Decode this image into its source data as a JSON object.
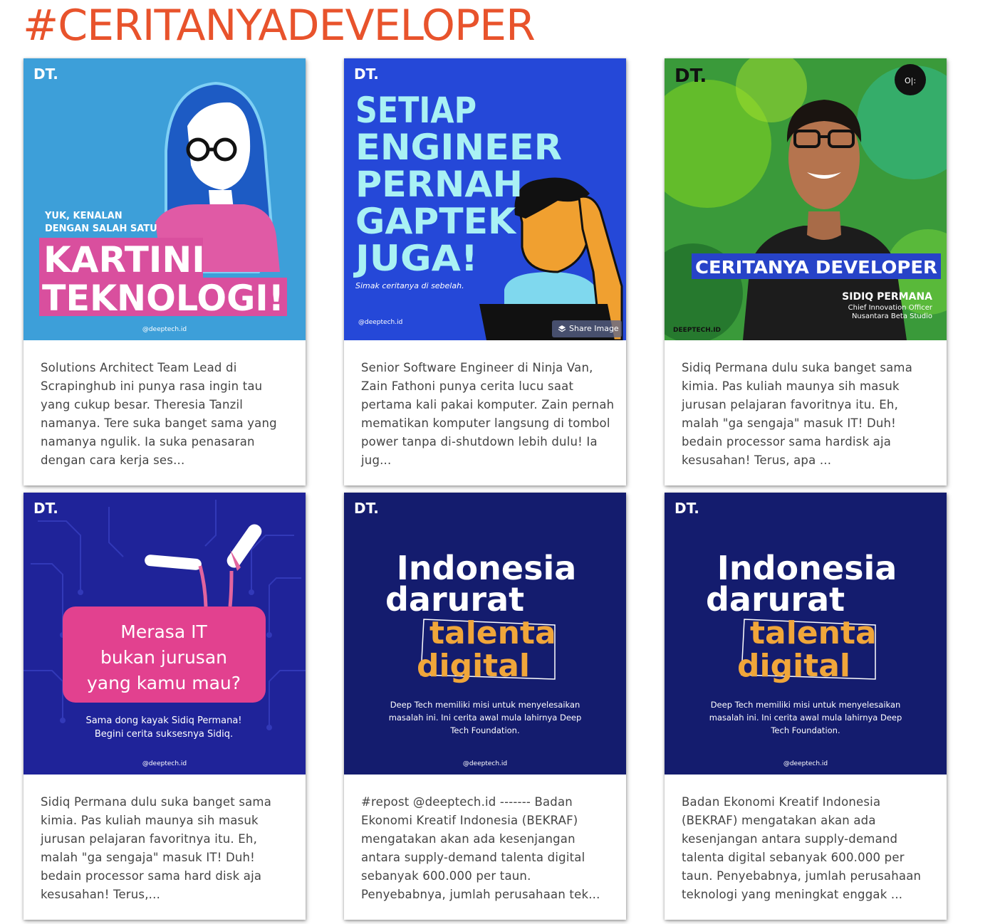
{
  "page": {
    "heading": "#CERITANYADEVELOPER"
  },
  "posts": [
    {
      "image": {
        "logo": "DT.",
        "intro_line1": "YUK, KENALAN",
        "intro_line2": "DENGAN SALAH SATU",
        "title_line1": "KARTINI",
        "title_line2": "TEKNOLOGI!",
        "handle": "@deeptech.id",
        "bg_color": "#3d9fd9"
      },
      "caption": "Solutions Architect Team Lead di Scrapinghub ini punya rasa ingin tau yang cukup besar. Theresia Tanzil namanya.  Tere suka banget sama yang namanya ngulik. Ia suka penasaran dengan cara kerja ses..."
    },
    {
      "image": {
        "logo": "DT.",
        "title_lines": [
          "SETIAP",
          "ENGINEER",
          "PERNAH",
          "GAPTEK",
          "JUGA!"
        ],
        "subtitle": "Simak ceritanya di sebelah.",
        "handle": "@deeptech.id",
        "bg_color": "#2548d8"
      },
      "share_label": "Share Image",
      "caption": "Senior Software Engineer di Ninja Van, Zain Fathoni punya cerita lucu saat pertama kali pakai komputer.  Zain pernah mematikan komputer langsung di tombol power tanpa di-shutdown lebih dulu! Ia jug..."
    },
    {
      "image": {
        "logo": "DT.",
        "banner": "CERITANYA DEVELOPER",
        "name": "SIDIQ PERMANA",
        "role_line1": "Chief Innovation Officer",
        "role_line2": "Nusantara Beta Studio",
        "brand": "DEEPTECH.ID"
      },
      "caption": "Sidiq Permana dulu suka banget sama kimia. Pas kuliah maunya sih masuk jurusan pelajaran favoritnya itu. Eh, malah \"ga sengaja\" masuk IT! Duh! bedain processor sama hardisk aja kesusahan! Terus, apa ..."
    },
    {
      "image": {
        "logo": "DT.",
        "bubble_lines": [
          "Merasa IT",
          "bukan jurusan",
          "yang kamu mau?"
        ],
        "sub_lines": [
          "Sama dong kayak Sidiq Permana!",
          "Begini cerita suksesnya Sidiq."
        ],
        "handle": "@deeptech.id",
        "bg_color": "#1f2399"
      },
      "caption": "Sidiq Permana dulu suka banget sama kimia. Pas kuliah maunya sih masuk jurusan pelajaran favoritnya itu. Eh, malah \"ga sengaja\" masuk IT! Duh! bedain processor sama hard disk aja kesusahan!  Terus,..."
    },
    {
      "image": {
        "logo": "DT.",
        "headline_line1": "Indonesia",
        "headline_line2": "darurat",
        "highlight_line1": "talenta",
        "highlight_line2": "digital",
        "body_lines": [
          "Deep Tech memiliki misi untuk menyelesaikan",
          "masalah ini. Ini cerita awal mula lahirnya Deep",
          "Tech Foundation."
        ],
        "handle": "@deeptech.id",
        "bg_color": "#141c6e"
      },
      "caption": "#repost @deeptech.id ------- Badan Ekonomi Kreatif Indonesia (BEKRAF) mengatakan akan ada kesenjangan antara supply-demand talenta digital sebanyak 600.000 per taun. Penyebabnya, jumlah perusahaan tek..."
    },
    {
      "image": {
        "logo": "DT.",
        "headline_line1": "Indonesia",
        "headline_line2": "darurat",
        "highlight_line1": "talenta",
        "highlight_line2": "digital",
        "body_lines": [
          "Deep Tech memiliki misi untuk menyelesaikan",
          "masalah ini. Ini cerita awal mula lahirnya Deep",
          "Tech Foundation."
        ],
        "handle": "@deeptech.id",
        "bg_color": "#141c6e"
      },
      "caption": "Badan Ekonomi Kreatif Indonesia (BEKRAF) mengatakan akan ada kesenjangan antara supply-demand talenta digital sebanyak 600.000 per taun. Penyebabnya, jumlah perusahaan teknologi yang meningkat enggak ..."
    }
  ]
}
